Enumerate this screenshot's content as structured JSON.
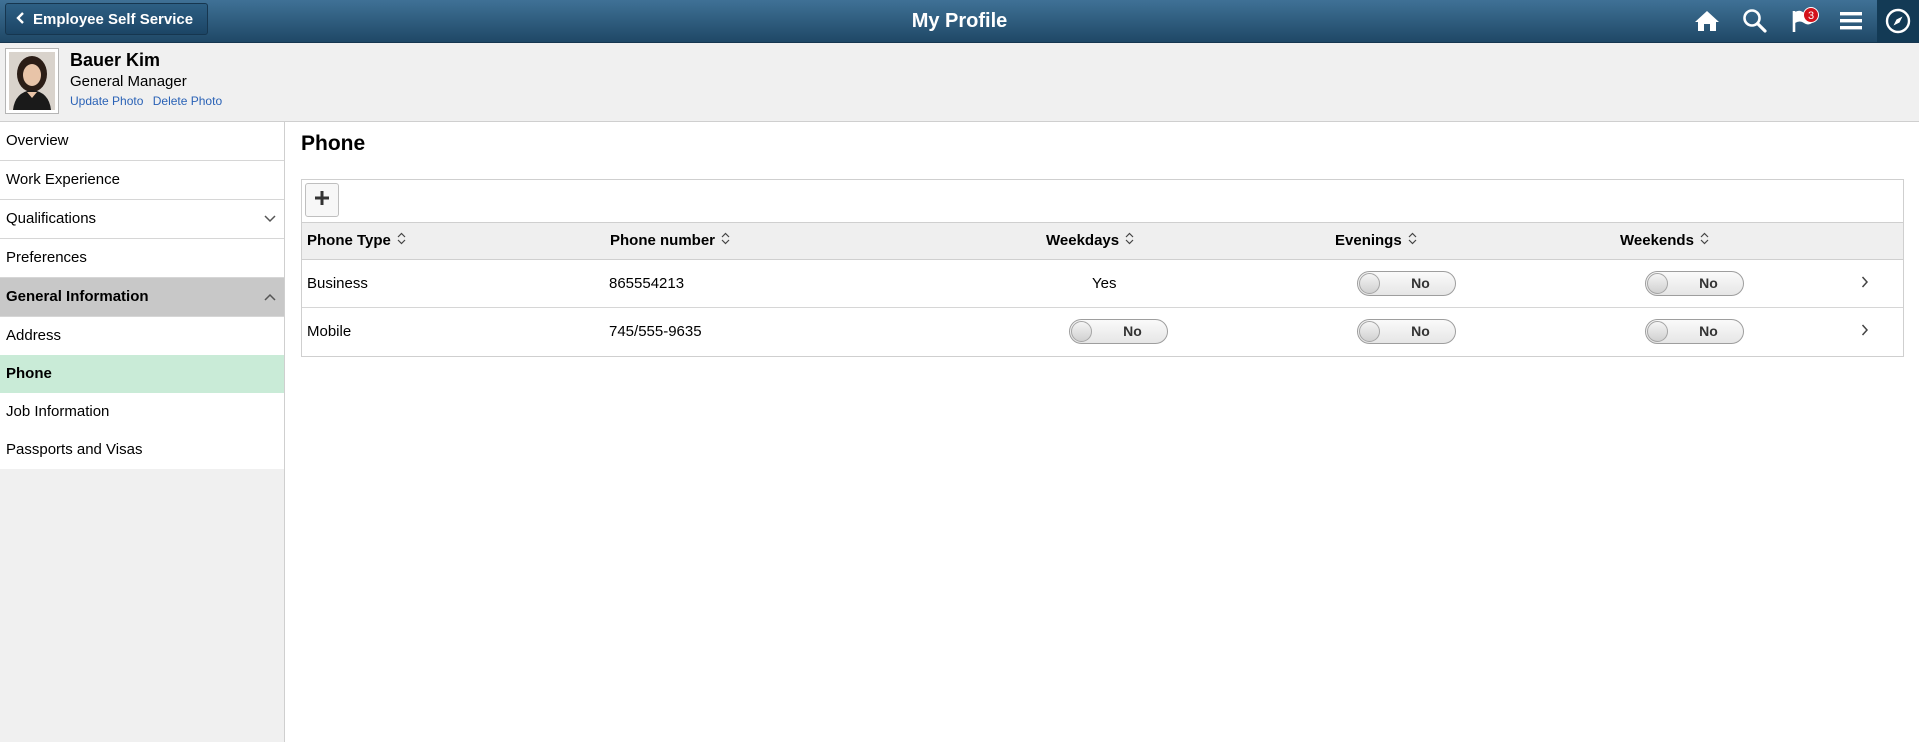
{
  "header": {
    "back_label": "Employee Self Service",
    "title": "My Profile",
    "notification_count": "3",
    "icons": [
      "home-icon",
      "search-icon",
      "flag-notification-icon",
      "menu-icon",
      "navbar-compass-icon"
    ]
  },
  "profile": {
    "name": "Bauer Kim",
    "job_title": "General Manager",
    "update_photo": "Update Photo",
    "delete_photo": "Delete Photo"
  },
  "sidebar": {
    "items": [
      {
        "label": "Overview"
      },
      {
        "label": "Work Experience"
      },
      {
        "label": "Qualifications"
      },
      {
        "label": "Preferences"
      },
      {
        "label": "General Information"
      },
      {
        "label": "Address"
      },
      {
        "label": "Phone"
      },
      {
        "label": "Job Information"
      },
      {
        "label": "Passports and Visas"
      }
    ]
  },
  "main": {
    "section_title": "Phone",
    "columns": [
      "Phone Type",
      "Phone number",
      "Weekdays",
      "Evenings",
      "Weekends"
    ],
    "rows": [
      {
        "type": "Business",
        "number": "865554213",
        "weekdays": "Yes",
        "evenings": "No",
        "weekends": "No"
      },
      {
        "type": "Mobile",
        "number": "745/555-9635",
        "weekdays": "No",
        "evenings": "No",
        "weekends": "No"
      }
    ]
  },
  "colors": {
    "header_bg": "#2a5a80",
    "active_item": "#c9ebd7",
    "link": "#2a62b6",
    "badge": "#d3121b"
  }
}
